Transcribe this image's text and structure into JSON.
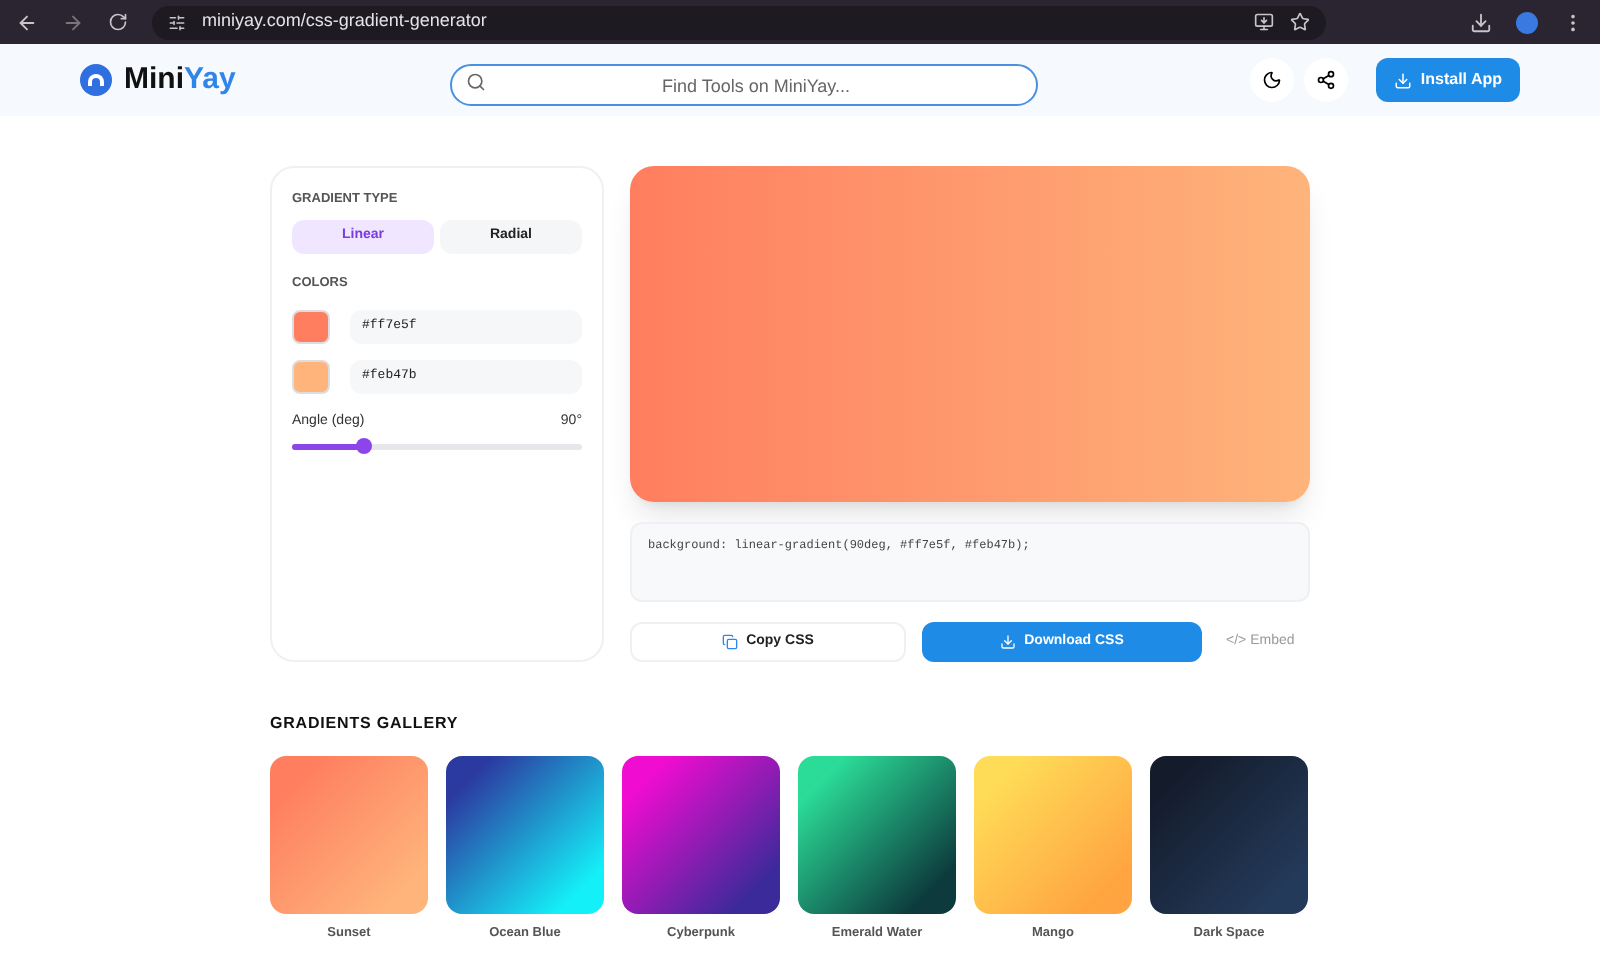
{
  "browser": {
    "url": "miniyay.com/css-gradient-generator"
  },
  "header": {
    "brand": [
      "Mini",
      "Yay"
    ],
    "search": {
      "placeholder": "Find Tools on MiniYay..."
    },
    "install_button": "Install App"
  },
  "controls": {
    "type_label": "GRADIENT TYPE",
    "types": [
      {
        "label": "Linear",
        "selected": true
      },
      {
        "label": "Radial",
        "selected": false
      }
    ],
    "colors_label": "COLORS",
    "colors": [
      {
        "value": "#ff7e5f",
        "color": "#ff7e5f"
      },
      {
        "value": "#feb47b",
        "color": "#feb47b"
      }
    ],
    "angle": {
      "label": "Angle (deg)",
      "reading": "90°",
      "level": 0.25
    }
  },
  "output": {
    "css": "background: linear-gradient(90deg, #ff7e5f, #feb47b);",
    "copy_button": "Copy CSS",
    "download_button": "Download CSS",
    "embed_link": "</> Embed"
  },
  "gallery": {
    "title": "GRADIENTS GALLERY",
    "items": [
      {
        "name": "Sunset",
        "stops": [
          {
            "color": "#ff7e5f"
          },
          {
            "color": "#feb47b"
          }
        ]
      },
      {
        "name": "Ocean Blue",
        "stops": [
          {
            "color": "#2b3aa0"
          },
          {
            "color": "#14f0f8"
          }
        ]
      },
      {
        "name": "Cyberpunk",
        "stops": [
          {
            "color": "#f00cd0"
          },
          {
            "color": "#3a2a9a"
          }
        ]
      },
      {
        "name": "Emerald Water",
        "stops": [
          {
            "color": "#2bdc98"
          },
          {
            "color": "#0d3a3c"
          }
        ]
      },
      {
        "name": "Mango",
        "stops": [
          {
            "color": "#ffdc58"
          },
          {
            "color": "#ffa440"
          }
        ]
      },
      {
        "name": "Dark Space",
        "stops": [
          {
            "color": "#141c2c"
          },
          {
            "color": "#243a5a"
          }
        ]
      }
    ]
  }
}
